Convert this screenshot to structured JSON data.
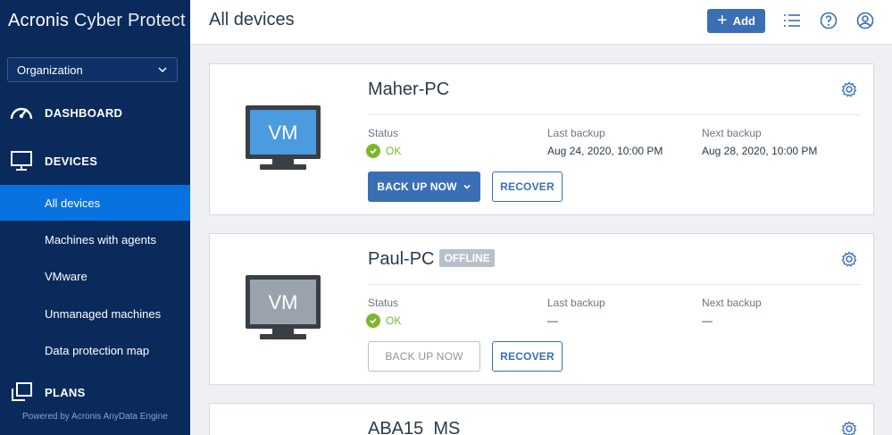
{
  "sidebar": {
    "brand_primary": "Acronis",
    "brand_secondary": "Cyber Protect",
    "org_select": "Organization",
    "nav": {
      "dashboard": "DASHBOARD",
      "devices": "DEVICES",
      "plans": "PLANS"
    },
    "sub_items": [
      {
        "label": "All devices"
      },
      {
        "label": "Machines with agents"
      },
      {
        "label": "VMware"
      },
      {
        "label": "Unmanaged machines"
      },
      {
        "label": "Data protection map"
      }
    ],
    "footer": "Powered by Acronis AnyData Engine"
  },
  "header": {
    "title": "All devices",
    "add_label": "Add"
  },
  "labels": {
    "status": "Status",
    "last_backup": "Last backup",
    "next_backup": "Next backup",
    "back_up_now": "BACK UP NOW",
    "recover": "RECOVER",
    "vm": "VM"
  },
  "devices": [
    {
      "name": "Maher-PC",
      "badge": "",
      "status": "OK",
      "last_backup": "Aug 24, 2020, 10:00 PM",
      "next_backup": "Aug 28, 2020, 10:00 PM"
    },
    {
      "name": "Paul-PC",
      "badge": "OFFLINE",
      "status": "OK",
      "last_backup": "—",
      "next_backup": "—"
    },
    {
      "name": "ABA15_MS"
    }
  ],
  "colors": {
    "sidebar_bg": "#0a2a5c",
    "active_item": "#0872e0",
    "primary_button": "#3a6fb5",
    "status_ok": "#7ab829",
    "vm_screen_online": "#4a9be0",
    "vm_screen_offline": "#9aa3ad"
  }
}
